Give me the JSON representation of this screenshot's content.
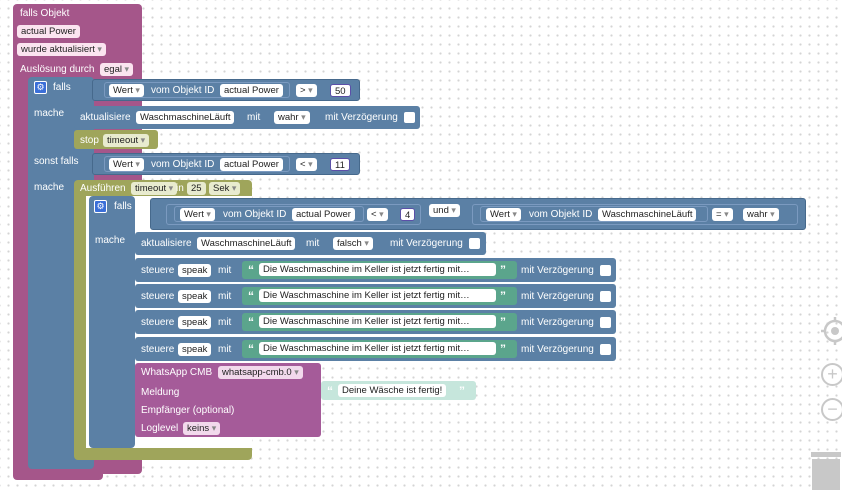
{
  "trigger": {
    "title": "falls Objekt",
    "object": "actual Power",
    "event": "wurde aktualisiert",
    "ack_label": "Auslösung durch",
    "ack_value": "egal"
  },
  "if1": {
    "falls": "falls",
    "mache": "mache",
    "sonst_falls": "sonst falls",
    "cond1": {
      "wert": "Wert",
      "vom": "vom Objekt ID",
      "obj": "actual Power",
      "op": ">",
      "num": "50"
    },
    "update": {
      "label": "aktualisiere",
      "obj": "WaschmaschineLäuft",
      "mit": "mit",
      "val": "wahr",
      "delay": "mit Verzögerung"
    },
    "stop": {
      "label": "stop",
      "val": "timeout"
    },
    "cond2": {
      "wert": "Wert",
      "vom": "vom Objekt ID",
      "obj": "actual Power",
      "op": "<",
      "num": "11"
    }
  },
  "timeout": {
    "label": "Ausführen",
    "var": "timeout",
    "in": "in",
    "num": "25",
    "unit": "Sek"
  },
  "if2": {
    "falls": "falls",
    "mache": "mache",
    "a": {
      "wert": "Wert",
      "vom": "vom Objekt ID",
      "obj": "actual Power",
      "op": "<",
      "num": "4"
    },
    "und": "und",
    "b": {
      "wert": "Wert",
      "vom": "vom Objekt ID",
      "obj": "WaschmaschineLäuft",
      "op": "=",
      "val": "wahr"
    },
    "update": {
      "label": "aktualisiere",
      "obj": "WaschmaschineLäuft",
      "mit": "mit",
      "val": "falsch",
      "delay": "mit Verzögerung"
    },
    "speak_rows": [
      {
        "label": "steuere",
        "dev": "speak",
        "mit": "mit",
        "text": "Die Waschmaschine im Keller ist jetzt fertig mit…",
        "delay": "mit Verzögerung"
      },
      {
        "label": "steuere",
        "dev": "speak",
        "mit": "mit",
        "text": "Die Waschmaschine im Keller ist jetzt fertig mit…",
        "delay": "mit Verzögerung"
      },
      {
        "label": "steuere",
        "dev": "speak",
        "mit": "mit",
        "text": "Die Waschmaschine im Keller ist jetzt fertig mit…",
        "delay": "mit Verzögerung"
      },
      {
        "label": "steuere",
        "dev": "speak",
        "mit": "mit",
        "text": "Die Waschmaschine im Keller ist jetzt fertig mit…",
        "delay": "mit Verzögerung"
      }
    ],
    "whatsapp": {
      "label": "WhatsApp CMB",
      "instance": "whatsapp-cmb.0",
      "msg_label": "Meldung",
      "msg_text": "Deine Wäsche ist fertig!",
      "recipient_label": "Empfänger (optional)",
      "loglevel_label": "Loglevel",
      "loglevel": "keins"
    }
  },
  "quotes": {
    "open": "“",
    "close": "”"
  },
  "icons": {
    "gear": "gear-icon",
    "recenter": "target-icon",
    "zoom_in": "plus-icon",
    "zoom_out": "minus-icon",
    "trash": "trash-icon"
  },
  "colors": {
    "trigger": "#a5568a",
    "logic": "#5b80a5",
    "value": "#5b80a5",
    "timer": "#9fa55b",
    "text": "#5ba58c",
    "whatsapp": "#a55b99"
  }
}
